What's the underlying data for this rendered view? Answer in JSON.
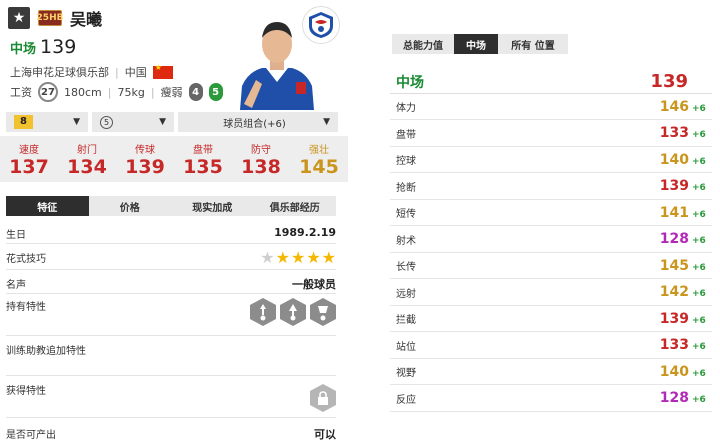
{
  "player": {
    "season_badge": "25HB",
    "name": "吴曦",
    "position": "中场",
    "ovr": "139",
    "club": "上海申花足球俱乐部",
    "nation": "中国",
    "wage_label": "工资",
    "wage": "27",
    "height": "180cm",
    "weight": "75kg",
    "body": "瘦弱",
    "weak_foot": "4",
    "strong_foot": "5"
  },
  "selectors": {
    "level": "8",
    "upgrade": "5",
    "chemistry": "球员组合(+6)"
  },
  "summary_stats": [
    {
      "label": "速度",
      "value": "137"
    },
    {
      "label": "射门",
      "value": "134"
    },
    {
      "label": "传球",
      "value": "139"
    },
    {
      "label": "盘带",
      "value": "135"
    },
    {
      "label": "防守",
      "value": "138"
    },
    {
      "label": "强壮",
      "value": "145"
    }
  ],
  "left_tabs": [
    "特征",
    "价格",
    "现实加成",
    "俱乐部经历"
  ],
  "details": {
    "birthday_label": "生日",
    "birthday": "1989.2.19",
    "skill_label": "花式技巧",
    "skill_stars": 4,
    "reputation_label": "名声",
    "reputation": "一般球员",
    "traits_label": "持有特性",
    "coach_traits_label": "训练助教追加特性",
    "acquire_traits_label": "获得特性",
    "producible_label": "是否可产出",
    "producible": "可以"
  },
  "right_tabs": [
    "总能力值",
    "中场",
    "所有 位置"
  ],
  "right_header": {
    "position": "中场",
    "ovr": "139"
  },
  "attributes": [
    {
      "name": "体力",
      "value": "146",
      "bonus": "+6",
      "color": "#c9951c"
    },
    {
      "name": "盘带",
      "value": "133",
      "bonus": "+6",
      "color": "#c62828"
    },
    {
      "name": "控球",
      "value": "140",
      "bonus": "+6",
      "color": "#c9951c"
    },
    {
      "name": "抢断",
      "value": "139",
      "bonus": "+6",
      "color": "#c62828"
    },
    {
      "name": "短传",
      "value": "141",
      "bonus": "+6",
      "color": "#c9951c"
    },
    {
      "name": "射术",
      "value": "128",
      "bonus": "+6",
      "color": "#b02ab5"
    },
    {
      "name": "长传",
      "value": "145",
      "bonus": "+6",
      "color": "#c9951c"
    },
    {
      "name": "远射",
      "value": "142",
      "bonus": "+6",
      "color": "#c9951c"
    },
    {
      "name": "拦截",
      "value": "139",
      "bonus": "+6",
      "color": "#c62828"
    },
    {
      "name": "站位",
      "value": "133",
      "bonus": "+6",
      "color": "#c62828"
    },
    {
      "name": "视野",
      "value": "140",
      "bonus": "+6",
      "color": "#c9951c"
    },
    {
      "name": "反应",
      "value": "128",
      "bonus": "+6",
      "color": "#b02ab5"
    }
  ]
}
